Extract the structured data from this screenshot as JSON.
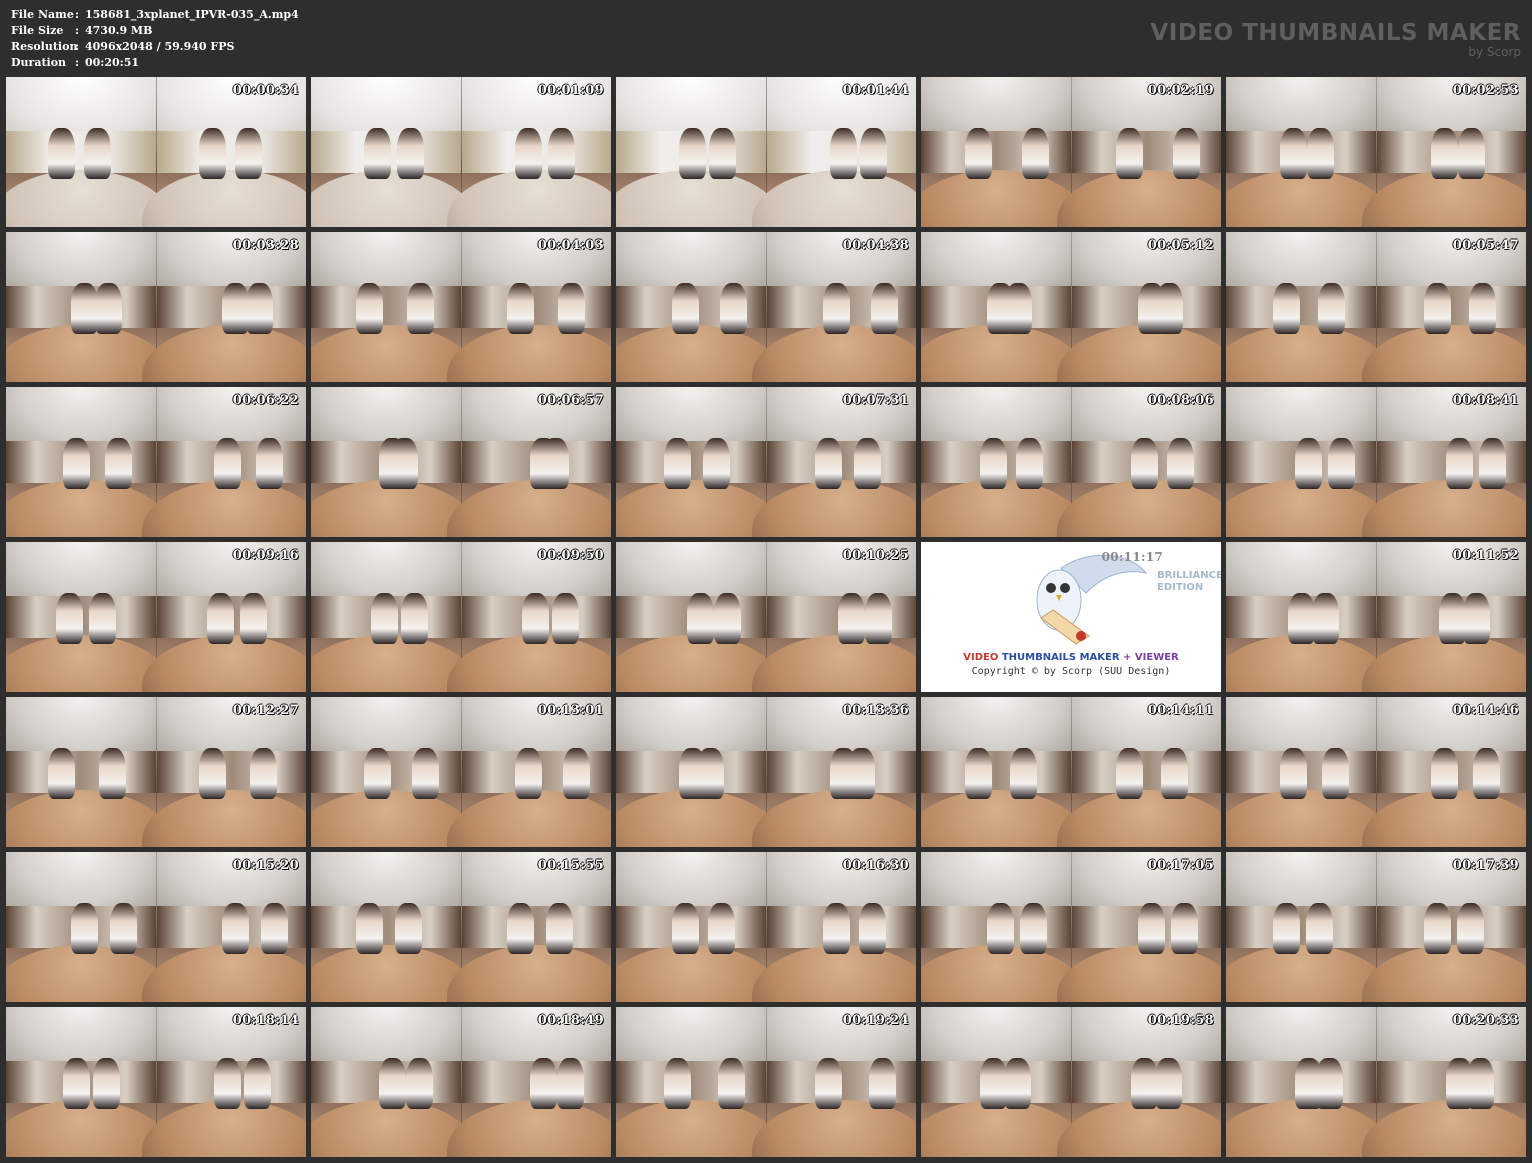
{
  "info": [
    {
      "label": "File Name",
      "value": "158681_3xplanet_IPVR-035_A.mp4"
    },
    {
      "label": "File Size",
      "value": "4730.9 MB"
    },
    {
      "label": "Resolution",
      "value": "4096x2048 / 59.940 FPS"
    },
    {
      "label": "Duration",
      "value": "00:20:51"
    }
  ],
  "separator": ":",
  "brand": {
    "title": "VIDEO THUMBNAILS MAKER",
    "subtitle": "by Scorp"
  },
  "thumbnails": [
    "00:00:34",
    "00:01:09",
    "00:01:44",
    "00:02:19",
    "00:02:53",
    "00:03:28",
    "00:04:03",
    "00:04:38",
    "00:05:12",
    "00:05:47",
    "00:06:22",
    "00:06:57",
    "00:07:31",
    "00:08:06",
    "00:08:41",
    "00:09:16",
    "00:09:50",
    "00:10:25",
    "00:11:17",
    "00:11:52",
    "00:12:27",
    "00:13:01",
    "00:13:36",
    "00:14:11",
    "00:14:46",
    "00:15:20",
    "00:15:55",
    "00:16:30",
    "00:17:05",
    "00:17:39",
    "00:18:14",
    "00:18:49",
    "00:19:24",
    "00:19:58",
    "00:20:33"
  ],
  "logo_tile": {
    "edition_line1": "BRILLIANCE",
    "edition_line2": "EDITION",
    "title_part1": "VIDEO ",
    "title_part2": "THUMBNAILS MAKER",
    "title_part3": " + VIEWER",
    "copyright": "Copyright © by Scorp (SUU Design)"
  },
  "colors": {
    "background": "#2e2e2e",
    "text": "#ffffff",
    "brand": "#5f5f5f"
  }
}
